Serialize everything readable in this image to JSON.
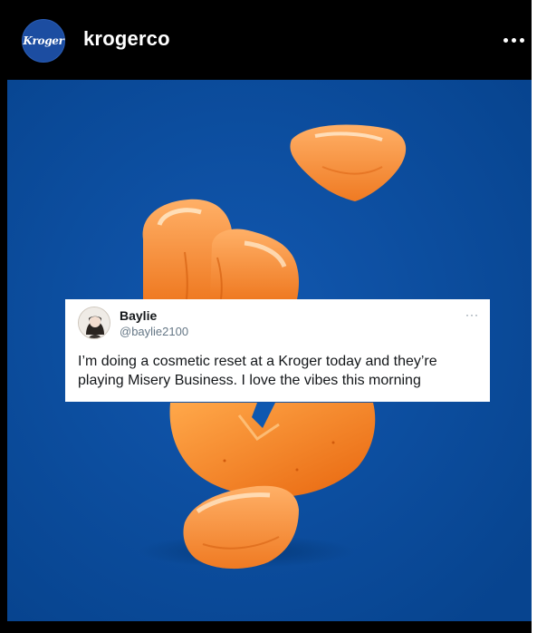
{
  "account": {
    "logo_text": "Kroger",
    "username": "krogerco",
    "more_icon": "more-horizontal-icon"
  },
  "tweet": {
    "display_name": "Baylie",
    "handle": "@baylie2100",
    "text": "I’m doing a cosmetic reset at a Kroger today and they’re playing Misery Business. I love the vibes this morning",
    "more_label": "···"
  },
  "colors": {
    "background_blue": "#0a4ea4",
    "orange": "#f07a1c",
    "header": "#000000"
  }
}
